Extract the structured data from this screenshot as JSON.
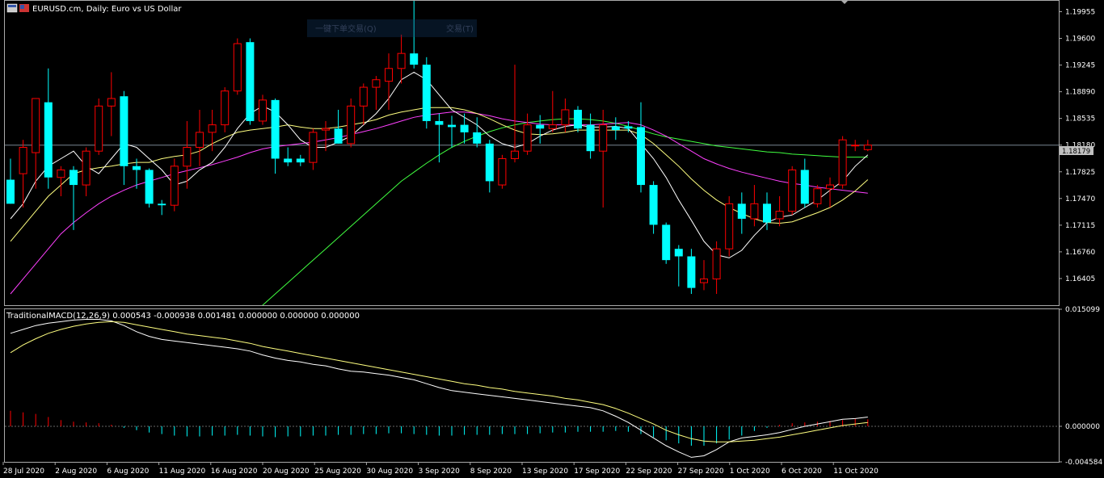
{
  "window": {
    "title": "EURUSD.cm, Daily:  Euro vs US Dollar",
    "overlay_left": "一键下单交易(Q)",
    "overlay_right": "交易(T)"
  },
  "colors": {
    "bull": "#ff0000",
    "bear": "#00ffff",
    "ma_fast": "#ffffff",
    "ma_mid": "#ffff80",
    "ma_slow": "#ff40ff",
    "ma_long": "#40ff40",
    "macd_line": "#ffffff",
    "signal_line": "#ffff80",
    "grid": "#aaaaaa"
  },
  "chart_data": [
    {
      "type": "candlestick",
      "title": "EURUSD.cm, Daily:  Euro vs US Dollar",
      "ylim": [
        1.1605,
        1.201
      ],
      "y_ticks": [
        "1.19955",
        "1.19600",
        "1.19245",
        "1.18890",
        "1.18535",
        "1.18180",
        "1.17825",
        "1.17470",
        "1.17115",
        "1.16760",
        "1.16405"
      ],
      "current_price": "1.18179",
      "x_labels": [
        "28 Jul 2020",
        "2 Aug 2020",
        "6 Aug 2020",
        "11 Aug 2020",
        "16 Aug 2020",
        "20 Aug 2020",
        "25 Aug 2020",
        "30 Aug 2020",
        "3 Sep 2020",
        "8 Sep 2020",
        "13 Sep 2020",
        "17 Sep 2020",
        "22 Sep 2020",
        "27 Sep 2020",
        "1 Oct 2020",
        "6 Oct 2020",
        "11 Oct 2020"
      ],
      "candles": [
        {
          "o": 1.1772,
          "h": 1.18,
          "l": 1.174,
          "c": 1.174
        },
        {
          "o": 1.178,
          "h": 1.1825,
          "l": 1.1735,
          "c": 1.1815
        },
        {
          "o": 1.1808,
          "h": 1.188,
          "l": 1.176,
          "c": 1.188
        },
        {
          "o": 1.1875,
          "h": 1.192,
          "l": 1.176,
          "c": 1.1775
        },
        {
          "o": 1.1775,
          "h": 1.179,
          "l": 1.175,
          "c": 1.1785
        },
        {
          "o": 1.1785,
          "h": 1.179,
          "l": 1.1705,
          "c": 1.1765
        },
        {
          "o": 1.1765,
          "h": 1.1815,
          "l": 1.175,
          "c": 1.181
        },
        {
          "o": 1.181,
          "h": 1.188,
          "l": 1.1805,
          "c": 1.187
        },
        {
          "o": 1.187,
          "h": 1.1915,
          "l": 1.183,
          "c": 1.188
        },
        {
          "o": 1.1883,
          "h": 1.189,
          "l": 1.1765,
          "c": 1.179
        },
        {
          "o": 1.179,
          "h": 1.18,
          "l": 1.176,
          "c": 1.1785
        },
        {
          "o": 1.1785,
          "h": 1.1787,
          "l": 1.1735,
          "c": 1.174
        },
        {
          "o": 1.174,
          "h": 1.1745,
          "l": 1.1725,
          "c": 1.1738
        },
        {
          "o": 1.1738,
          "h": 1.18,
          "l": 1.173,
          "c": 1.179
        },
        {
          "o": 1.179,
          "h": 1.185,
          "l": 1.176,
          "c": 1.1815
        },
        {
          "o": 1.1815,
          "h": 1.1865,
          "l": 1.179,
          "c": 1.1835
        },
        {
          "o": 1.1835,
          "h": 1.1865,
          "l": 1.181,
          "c": 1.1845
        },
        {
          "o": 1.1845,
          "h": 1.1895,
          "l": 1.1835,
          "c": 1.189
        },
        {
          "o": 1.189,
          "h": 1.196,
          "l": 1.1885,
          "c": 1.1953
        },
        {
          "o": 1.1955,
          "h": 1.196,
          "l": 1.1845,
          "c": 1.185
        },
        {
          "o": 1.185,
          "h": 1.1885,
          "l": 1.1845,
          "c": 1.1878
        },
        {
          "o": 1.1878,
          "h": 1.188,
          "l": 1.178,
          "c": 1.18
        },
        {
          "o": 1.18,
          "h": 1.1815,
          "l": 1.179,
          "c": 1.1795
        },
        {
          "o": 1.18,
          "h": 1.1805,
          "l": 1.179,
          "c": 1.1795
        },
        {
          "o": 1.1795,
          "h": 1.184,
          "l": 1.1785,
          "c": 1.1835
        },
        {
          "o": 1.1838,
          "h": 1.185,
          "l": 1.181,
          "c": 1.184
        },
        {
          "o": 1.184,
          "h": 1.1865,
          "l": 1.182,
          "c": 1.182
        },
        {
          "o": 1.182,
          "h": 1.188,
          "l": 1.1815,
          "c": 1.187
        },
        {
          "o": 1.187,
          "h": 1.19,
          "l": 1.1845,
          "c": 1.1895
        },
        {
          "o": 1.1895,
          "h": 1.191,
          "l": 1.1865,
          "c": 1.1905
        },
        {
          "o": 1.1903,
          "h": 1.194,
          "l": 1.1865,
          "c": 1.192
        },
        {
          "o": 1.192,
          "h": 1.1965,
          "l": 1.19,
          "c": 1.194
        },
        {
          "o": 1.194,
          "h": 1.201,
          "l": 1.192,
          "c": 1.1925
        },
        {
          "o": 1.1925,
          "h": 1.1935,
          "l": 1.184,
          "c": 1.185
        },
        {
          "o": 1.185,
          "h": 1.186,
          "l": 1.1795,
          "c": 1.1845
        },
        {
          "o": 1.1845,
          "h": 1.1857,
          "l": 1.1815,
          "c": 1.1842
        },
        {
          "o": 1.1845,
          "h": 1.186,
          "l": 1.182,
          "c": 1.1835
        },
        {
          "o": 1.1835,
          "h": 1.1855,
          "l": 1.1815,
          "c": 1.182
        },
        {
          "o": 1.182,
          "h": 1.1825,
          "l": 1.1755,
          "c": 1.177
        },
        {
          "o": 1.1765,
          "h": 1.1805,
          "l": 1.176,
          "c": 1.18
        },
        {
          "o": 1.18,
          "h": 1.1925,
          "l": 1.1795,
          "c": 1.181
        },
        {
          "o": 1.181,
          "h": 1.186,
          "l": 1.1805,
          "c": 1.1845
        },
        {
          "o": 1.1845,
          "h": 1.1858,
          "l": 1.182,
          "c": 1.184
        },
        {
          "o": 1.184,
          "h": 1.189,
          "l": 1.1835,
          "c": 1.1845
        },
        {
          "o": 1.1845,
          "h": 1.188,
          "l": 1.1835,
          "c": 1.1865
        },
        {
          "o": 1.1865,
          "h": 1.187,
          "l": 1.1835,
          "c": 1.184
        },
        {
          "o": 1.1845,
          "h": 1.186,
          "l": 1.18,
          "c": 1.181
        },
        {
          "o": 1.181,
          "h": 1.1865,
          "l": 1.1735,
          "c": 1.1845
        },
        {
          "o": 1.1843,
          "h": 1.1855,
          "l": 1.1825,
          "c": 1.1838
        },
        {
          "o": 1.1843,
          "h": 1.185,
          "l": 1.1835,
          "c": 1.184
        },
        {
          "o": 1.1842,
          "h": 1.1875,
          "l": 1.1755,
          "c": 1.1765
        },
        {
          "o": 1.1765,
          "h": 1.177,
          "l": 1.17,
          "c": 1.1712
        },
        {
          "o": 1.1712,
          "h": 1.1715,
          "l": 1.166,
          "c": 1.1665
        },
        {
          "o": 1.168,
          "h": 1.1685,
          "l": 1.163,
          "c": 1.167
        },
        {
          "o": 1.167,
          "h": 1.168,
          "l": 1.162,
          "c": 1.1628
        },
        {
          "o": 1.1635,
          "h": 1.1665,
          "l": 1.1625,
          "c": 1.164
        },
        {
          "o": 1.164,
          "h": 1.169,
          "l": 1.162,
          "c": 1.168
        },
        {
          "o": 1.168,
          "h": 1.175,
          "l": 1.167,
          "c": 1.174
        },
        {
          "o": 1.174,
          "h": 1.1755,
          "l": 1.17,
          "c": 1.172
        },
        {
          "o": 1.172,
          "h": 1.1765,
          "l": 1.171,
          "c": 1.174
        },
        {
          "o": 1.174,
          "h": 1.1755,
          "l": 1.1705,
          "c": 1.1715
        },
        {
          "o": 1.172,
          "h": 1.175,
          "l": 1.171,
          "c": 1.173
        },
        {
          "o": 1.173,
          "h": 1.179,
          "l": 1.1725,
          "c": 1.1785
        },
        {
          "o": 1.1785,
          "h": 1.18,
          "l": 1.1735,
          "c": 1.174
        },
        {
          "o": 1.174,
          "h": 1.1765,
          "l": 1.1735,
          "c": 1.176
        },
        {
          "o": 1.176,
          "h": 1.1775,
          "l": 1.1735,
          "c": 1.1765
        },
        {
          "o": 1.1765,
          "h": 1.183,
          "l": 1.176,
          "c": 1.1825
        },
        {
          "o": 1.1818,
          "h": 1.1825,
          "l": 1.181,
          "c": 1.1818
        },
        {
          "o": 1.1812,
          "h": 1.1825,
          "l": 1.181,
          "c": 1.1818
        }
      ],
      "ma_fast": [
        1.172,
        1.174,
        1.177,
        1.179,
        1.18,
        1.181,
        1.179,
        1.178,
        1.18,
        1.182,
        1.1815,
        1.18,
        1.1785,
        1.1765,
        1.177,
        1.1785,
        1.1795,
        1.1815,
        1.184,
        1.186,
        1.187,
        1.1862,
        1.1845,
        1.1825,
        1.1815,
        1.1815,
        1.1822,
        1.183,
        1.1845,
        1.186,
        1.188,
        1.1905,
        1.1915,
        1.1905,
        1.1885,
        1.1865,
        1.1855,
        1.1845,
        1.183,
        1.182,
        1.1815,
        1.182,
        1.183,
        1.1838,
        1.1843,
        1.1845,
        1.1842,
        1.1842,
        1.1843,
        1.184,
        1.182,
        1.18,
        1.1775,
        1.1745,
        1.1718,
        1.169,
        1.1672,
        1.1668,
        1.1678,
        1.1698,
        1.1715,
        1.1722,
        1.1725,
        1.1735,
        1.1745,
        1.1758,
        1.177,
        1.179,
        1.1805
      ],
      "ma_mid": [
        1.169,
        1.171,
        1.173,
        1.175,
        1.1765,
        1.178,
        1.1785,
        1.1788,
        1.179,
        1.1793,
        1.1795,
        1.1795,
        1.18,
        1.1803,
        1.1805,
        1.181,
        1.182,
        1.1828,
        1.1835,
        1.1838,
        1.184,
        1.1842,
        1.1845,
        1.1842,
        1.184,
        1.184,
        1.1842,
        1.1845,
        1.1848,
        1.1852,
        1.1858,
        1.1862,
        1.1865,
        1.1868,
        1.1868,
        1.1868,
        1.1865,
        1.186,
        1.1853,
        1.1845,
        1.1838,
        1.1833,
        1.1832,
        1.1833,
        1.1835,
        1.1838,
        1.1838,
        1.1838,
        1.1838,
        1.1838,
        1.1832,
        1.182,
        1.1805,
        1.179,
        1.1773,
        1.1758,
        1.1745,
        1.1735,
        1.1727,
        1.172,
        1.1715,
        1.1714,
        1.1716,
        1.1722,
        1.1728,
        1.1735,
        1.1745,
        1.1757,
        1.1772
      ],
      "ma_slow": [
        1.162,
        1.164,
        1.166,
        1.168,
        1.17,
        1.1715,
        1.1728,
        1.174,
        1.175,
        1.1758,
        1.1765,
        1.177,
        1.1775,
        1.178,
        1.1784,
        1.1788,
        1.1792,
        1.1797,
        1.1802,
        1.1808,
        1.1813,
        1.1816,
        1.1818,
        1.182,
        1.1822,
        1.1825,
        1.1828,
        1.1832,
        1.1836,
        1.184,
        1.1845,
        1.185,
        1.1855,
        1.1858,
        1.186,
        1.1862,
        1.1862,
        1.186,
        1.1857,
        1.1853,
        1.185,
        1.1848,
        1.1846,
        1.1845,
        1.1845,
        1.1845,
        1.1845,
        1.1846,
        1.1847,
        1.1848,
        1.1845,
        1.1838,
        1.183,
        1.182,
        1.181,
        1.18,
        1.1793,
        1.1787,
        1.1782,
        1.1778,
        1.1774,
        1.177,
        1.1767,
        1.1765,
        1.1762,
        1.176,
        1.1758,
        1.1756,
        1.1754
      ],
      "ma_long": [
        1.14,
        1.141,
        1.142,
        1.143,
        1.144,
        1.145,
        1.146,
        1.147,
        1.148,
        1.149,
        1.15,
        1.151,
        1.152,
        1.153,
        1.154,
        1.155,
        1.156,
        1.157,
        1.158,
        1.159,
        1.1605,
        1.162,
        1.1635,
        1.165,
        1.1665,
        1.168,
        1.1695,
        1.171,
        1.1725,
        1.174,
        1.1755,
        1.177,
        1.1782,
        1.1794,
        1.1805,
        1.1815,
        1.1823,
        1.183,
        1.1836,
        1.1841,
        1.1845,
        1.1848,
        1.185,
        1.1852,
        1.1853,
        1.1853,
        1.1852,
        1.185,
        1.1847,
        1.1843,
        1.1838,
        1.1833,
        1.1829,
        1.1826,
        1.1823,
        1.182,
        1.1817,
        1.1815,
        1.1813,
        1.1811,
        1.1809,
        1.1808,
        1.1806,
        1.1805,
        1.1804,
        1.1803,
        1.1802,
        1.1802,
        1.1802
      ]
    },
    {
      "type": "macd",
      "title": "TraditionalMACD(12,26,9) 0.000543 -0.000938 0.001481 0.000000 0.000000 0.000000",
      "ylim": [
        -0.004584,
        0.015099
      ],
      "y_ticks": [
        "0.015099",
        "0.000000",
        "-0.004584"
      ],
      "histogram": [
        0.002,
        0.0018,
        0.0016,
        0.0012,
        0.0008,
        0.0006,
        0.0005,
        0.0004,
        0.0002,
        -0.0002,
        -0.0005,
        -0.0008,
        -0.001,
        -0.0012,
        -0.0013,
        -0.0013,
        -0.0012,
        -0.0012,
        -0.0011,
        -0.0012,
        -0.0013,
        -0.0014,
        -0.0013,
        -0.0013,
        -0.0012,
        -0.0012,
        -0.0011,
        -0.0011,
        -0.001,
        -0.001,
        -0.0009,
        -0.0009,
        -0.001,
        -0.0011,
        -0.0012,
        -0.0012,
        -0.0011,
        -0.0011,
        -0.0011,
        -0.001,
        -0.001,
        -0.001,
        -0.0009,
        -0.0008,
        -0.0008,
        -0.0007,
        -0.0007,
        -0.0007,
        -0.0006,
        -0.0007,
        -0.001,
        -0.0014,
        -0.0018,
        -0.0022,
        -0.0025,
        -0.0025,
        -0.0022,
        -0.0017,
        -0.0012,
        -0.0006,
        -0.0002,
        0.0002,
        0.0004,
        0.0005,
        0.0006,
        0.0007,
        0.0008,
        0.001,
        0.0009
      ],
      "macd": [
        0.012,
        0.0125,
        0.013,
        0.0133,
        0.0135,
        0.0137,
        0.0138,
        0.0138,
        0.0136,
        0.013,
        0.0122,
        0.0116,
        0.0112,
        0.011,
        0.0108,
        0.0106,
        0.0104,
        0.0102,
        0.01,
        0.0097,
        0.0092,
        0.0088,
        0.0085,
        0.0083,
        0.008,
        0.0078,
        0.0074,
        0.0071,
        0.007,
        0.0068,
        0.0066,
        0.0063,
        0.006,
        0.0055,
        0.005,
        0.0046,
        0.0044,
        0.0042,
        0.004,
        0.0038,
        0.0036,
        0.0034,
        0.0032,
        0.003,
        0.0028,
        0.0026,
        0.0024,
        0.002,
        0.0013,
        0.0005,
        -0.0005,
        -0.0015,
        -0.0025,
        -0.0033,
        -0.004,
        -0.0038,
        -0.003,
        -0.002,
        -0.0015,
        -0.0013,
        -0.0011,
        -0.0008,
        -0.0004,
        0.0,
        0.0003,
        0.0006,
        0.0009,
        0.001,
        0.0012
      ],
      "signal": [
        0.0095,
        0.0105,
        0.0113,
        0.012,
        0.0125,
        0.0129,
        0.0132,
        0.0134,
        0.0135,
        0.0134,
        0.0131,
        0.0128,
        0.0125,
        0.0122,
        0.0119,
        0.0117,
        0.0115,
        0.0113,
        0.011,
        0.0107,
        0.0103,
        0.01,
        0.0097,
        0.0094,
        0.0091,
        0.0088,
        0.0085,
        0.0082,
        0.0079,
        0.0076,
        0.0073,
        0.007,
        0.0067,
        0.0064,
        0.0061,
        0.0058,
        0.0055,
        0.0053,
        0.005,
        0.0048,
        0.0045,
        0.0043,
        0.0041,
        0.0039,
        0.0036,
        0.0034,
        0.0031,
        0.0028,
        0.0023,
        0.0017,
        0.001,
        0.0003,
        -0.0005,
        -0.0011,
        -0.0016,
        -0.0019,
        -0.002,
        -0.002,
        -0.0019,
        -0.0018,
        -0.0016,
        -0.0014,
        -0.0011,
        -0.0008,
        -0.0005,
        -0.0002,
        0.0001,
        0.0003,
        0.0005
      ]
    }
  ]
}
